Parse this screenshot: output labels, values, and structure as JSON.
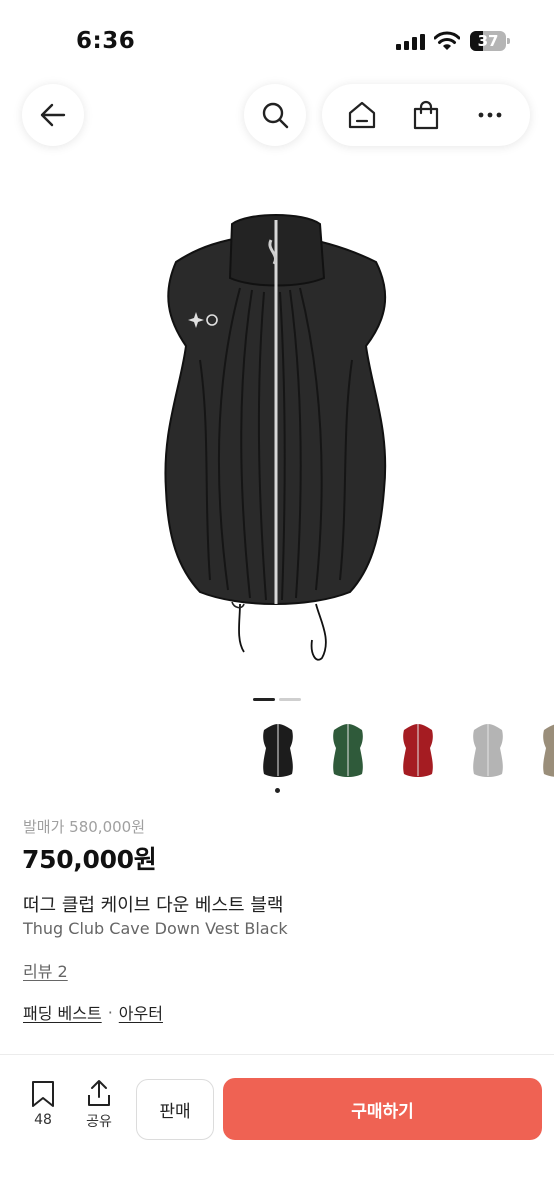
{
  "status": {
    "time": "6:36",
    "battery": "37",
    "battery_level": 0.37
  },
  "nav": {
    "back_icon": "arrow-left-icon",
    "search_icon": "search-icon",
    "home_icon": "home-icon",
    "cart_icon": "shopping-bag-icon",
    "more_icon": "more-horizontal-icon"
  },
  "gallery": {
    "image_count": 2,
    "current_index": 1
  },
  "thumbnails": [
    {
      "color_name": "black",
      "color": "#1c1c1c",
      "selected": true
    },
    {
      "color_name": "green",
      "color": "#2f5a3a",
      "selected": false
    },
    {
      "color_name": "red",
      "color": "#a51c22",
      "selected": false
    },
    {
      "color_name": "gray",
      "color": "#b4b4b4",
      "selected": false
    },
    {
      "color_name": "beige",
      "color": "#9a8e7a",
      "selected": false
    }
  ],
  "product": {
    "retail_price": "발매가 580,000원",
    "price": "750,000원",
    "name_ko": "떠그 클럽 케이브 다운 베스트 블랙",
    "name_en": "Thug Club Cave Down Vest Black",
    "review_link": "리뷰 2",
    "categories": [
      "패딩 베스트",
      "아우터"
    ]
  },
  "bottom_bar": {
    "bookmark_count": "48",
    "share_label": "공유",
    "sell_label": "판매",
    "buy_label": "구매하기"
  },
  "colors": {
    "buy_button": "#ef6253",
    "accent_dark": "#111111"
  }
}
